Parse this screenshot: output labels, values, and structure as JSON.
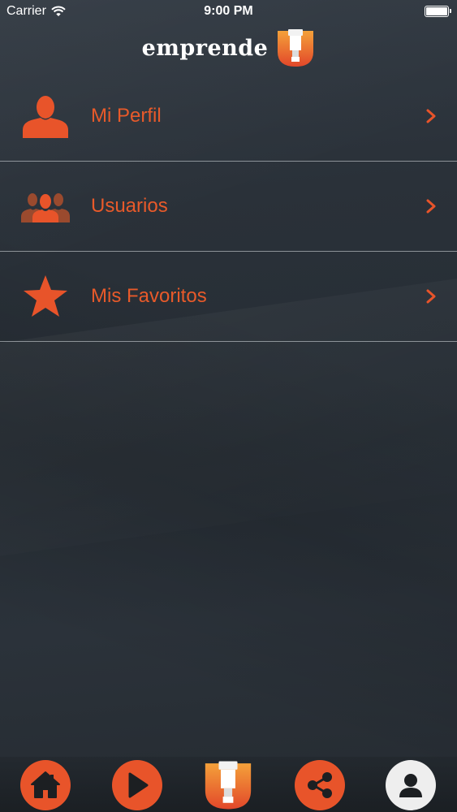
{
  "status_bar": {
    "carrier": "Carrier",
    "time": "9:00 PM",
    "icons": [
      "wifi-icon",
      "battery-icon"
    ]
  },
  "header": {
    "logo_text": "emprende"
  },
  "menu": {
    "items": [
      {
        "label": "Mi Perfil",
        "icon": "user-icon"
      },
      {
        "label": "Usuarios",
        "icon": "users-icon"
      },
      {
        "label": "Mis Favoritos",
        "icon": "star-icon"
      }
    ]
  },
  "tabbar": {
    "items": [
      "home-icon",
      "play-icon",
      "logo-icon",
      "share-icon",
      "profile-icon"
    ]
  },
  "colors": {
    "accent": "#e8542a",
    "background": "#2a3139",
    "divider": "#dce1e6"
  }
}
